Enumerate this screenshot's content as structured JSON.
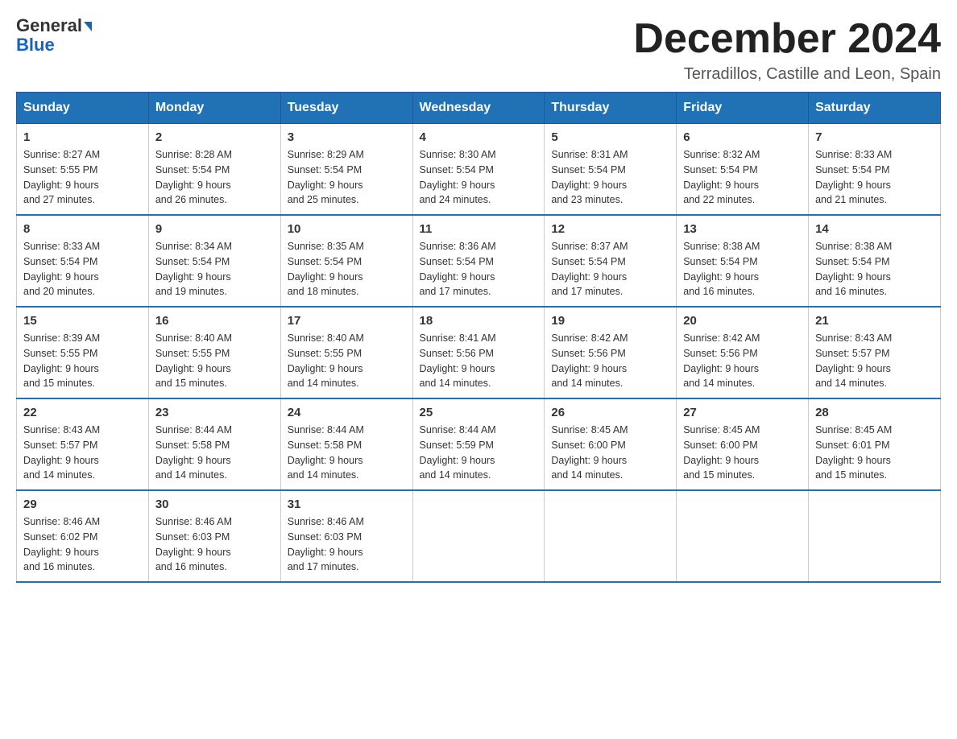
{
  "header": {
    "logo_line1": "General",
    "logo_line2": "Blue",
    "month_title": "December 2024",
    "location": "Terradillos, Castille and Leon, Spain"
  },
  "weekdays": [
    "Sunday",
    "Monday",
    "Tuesday",
    "Wednesday",
    "Thursday",
    "Friday",
    "Saturday"
  ],
  "weeks": [
    [
      {
        "day": "1",
        "sunrise": "8:27 AM",
        "sunset": "5:55 PM",
        "daylight": "9 hours and 27 minutes."
      },
      {
        "day": "2",
        "sunrise": "8:28 AM",
        "sunset": "5:54 PM",
        "daylight": "9 hours and 26 minutes."
      },
      {
        "day": "3",
        "sunrise": "8:29 AM",
        "sunset": "5:54 PM",
        "daylight": "9 hours and 25 minutes."
      },
      {
        "day": "4",
        "sunrise": "8:30 AM",
        "sunset": "5:54 PM",
        "daylight": "9 hours and 24 minutes."
      },
      {
        "day": "5",
        "sunrise": "8:31 AM",
        "sunset": "5:54 PM",
        "daylight": "9 hours and 23 minutes."
      },
      {
        "day": "6",
        "sunrise": "8:32 AM",
        "sunset": "5:54 PM",
        "daylight": "9 hours and 22 minutes."
      },
      {
        "day": "7",
        "sunrise": "8:33 AM",
        "sunset": "5:54 PM",
        "daylight": "9 hours and 21 minutes."
      }
    ],
    [
      {
        "day": "8",
        "sunrise": "8:33 AM",
        "sunset": "5:54 PM",
        "daylight": "9 hours and 20 minutes."
      },
      {
        "day": "9",
        "sunrise": "8:34 AM",
        "sunset": "5:54 PM",
        "daylight": "9 hours and 19 minutes."
      },
      {
        "day": "10",
        "sunrise": "8:35 AM",
        "sunset": "5:54 PM",
        "daylight": "9 hours and 18 minutes."
      },
      {
        "day": "11",
        "sunrise": "8:36 AM",
        "sunset": "5:54 PM",
        "daylight": "9 hours and 17 minutes."
      },
      {
        "day": "12",
        "sunrise": "8:37 AM",
        "sunset": "5:54 PM",
        "daylight": "9 hours and 17 minutes."
      },
      {
        "day": "13",
        "sunrise": "8:38 AM",
        "sunset": "5:54 PM",
        "daylight": "9 hours and 16 minutes."
      },
      {
        "day": "14",
        "sunrise": "8:38 AM",
        "sunset": "5:54 PM",
        "daylight": "9 hours and 16 minutes."
      }
    ],
    [
      {
        "day": "15",
        "sunrise": "8:39 AM",
        "sunset": "5:55 PM",
        "daylight": "9 hours and 15 minutes."
      },
      {
        "day": "16",
        "sunrise": "8:40 AM",
        "sunset": "5:55 PM",
        "daylight": "9 hours and 15 minutes."
      },
      {
        "day": "17",
        "sunrise": "8:40 AM",
        "sunset": "5:55 PM",
        "daylight": "9 hours and 14 minutes."
      },
      {
        "day": "18",
        "sunrise": "8:41 AM",
        "sunset": "5:56 PM",
        "daylight": "9 hours and 14 minutes."
      },
      {
        "day": "19",
        "sunrise": "8:42 AM",
        "sunset": "5:56 PM",
        "daylight": "9 hours and 14 minutes."
      },
      {
        "day": "20",
        "sunrise": "8:42 AM",
        "sunset": "5:56 PM",
        "daylight": "9 hours and 14 minutes."
      },
      {
        "day": "21",
        "sunrise": "8:43 AM",
        "sunset": "5:57 PM",
        "daylight": "9 hours and 14 minutes."
      }
    ],
    [
      {
        "day": "22",
        "sunrise": "8:43 AM",
        "sunset": "5:57 PM",
        "daylight": "9 hours and 14 minutes."
      },
      {
        "day": "23",
        "sunrise": "8:44 AM",
        "sunset": "5:58 PM",
        "daylight": "9 hours and 14 minutes."
      },
      {
        "day": "24",
        "sunrise": "8:44 AM",
        "sunset": "5:58 PM",
        "daylight": "9 hours and 14 minutes."
      },
      {
        "day": "25",
        "sunrise": "8:44 AM",
        "sunset": "5:59 PM",
        "daylight": "9 hours and 14 minutes."
      },
      {
        "day": "26",
        "sunrise": "8:45 AM",
        "sunset": "6:00 PM",
        "daylight": "9 hours and 14 minutes."
      },
      {
        "day": "27",
        "sunrise": "8:45 AM",
        "sunset": "6:00 PM",
        "daylight": "9 hours and 15 minutes."
      },
      {
        "day": "28",
        "sunrise": "8:45 AM",
        "sunset": "6:01 PM",
        "daylight": "9 hours and 15 minutes."
      }
    ],
    [
      {
        "day": "29",
        "sunrise": "8:46 AM",
        "sunset": "6:02 PM",
        "daylight": "9 hours and 16 minutes."
      },
      {
        "day": "30",
        "sunrise": "8:46 AM",
        "sunset": "6:03 PM",
        "daylight": "9 hours and 16 minutes."
      },
      {
        "day": "31",
        "sunrise": "8:46 AM",
        "sunset": "6:03 PM",
        "daylight": "9 hours and 17 minutes."
      },
      null,
      null,
      null,
      null
    ]
  ],
  "labels": {
    "sunrise": "Sunrise:",
    "sunset": "Sunset:",
    "daylight": "Daylight:"
  }
}
